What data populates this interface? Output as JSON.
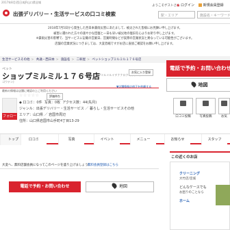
{
  "header": {
    "tagline": "2017年8月/西日本JR山口県全域",
    "logo_text": "出張デリバリー・生活サービスの口コミ検索",
    "welcome": "ようこそゲストさん",
    "login": "ログイン",
    "register": "新規会員登録",
    "search_area_placeholder": "駅・エリア",
    "search_keyword_placeholder": "施設名・キーワード"
  },
  "notice": {
    "line1": "2018年7月5日から発生した西日本豪雨災害にあたまして、被災された皆様にお見舞い申し上げます。",
    "line2": "被害に遭われた方々の速やかな回復と一日も早い被災地の復旧を心よりお祈り申し上げます。",
    "line3": "※豪雨災害の影響で、当サービスに記載の営業日、営業時間などが実際の営業状況と異なっている可能性がございます。",
    "line4": "店舗の営業状況につきましては、大変恐縮ですがお店に直接ご確認をお願い申し上げます。"
  },
  "breadcrumbs": [
    "生活サービスその他",
    "共通・西日本",
    "施設名",
    "二軒屋",
    "ペットショップミルミル１７６号店"
  ],
  "shop": {
    "category": "ペット",
    "title": "ショップミルミル１７６号店",
    "kana": "(ペットショップミルミルイチナナロクゴウテン)",
    "kana_short": "ゴウテン)",
    "edit_link": "お気に入り登録",
    "subnote": "最新の情報は店舗に確認の上ご利用ください",
    "subnote2": "▼店舗情報の修正を依頼する",
    "stars": "☆☆☆☆☆",
    "reviews_link": "評価待ち",
    "follow": "フォロー",
    "info": {
      "rating": "◆ 口コミ：0件",
      "photos": "写真：0枚",
      "access": "アクセス数：44(先月)",
      "genre": "ジャンル：出張デリバリー・生活サービス ／ 暮らし・生活サービスその他",
      "area": "エリア：山口県 ／ 岩国市周辺",
      "address": "住所：山口県岩国市山手町4丁目13-29"
    }
  },
  "actions": {
    "primary": "電話で予約・お問い合わせ",
    "map": "地図",
    "reviews_post": "口コミ投稿",
    "photo_post": "写真投稿",
    "third": "お気"
  },
  "tabs": [
    "トップ",
    "口コミ",
    "写真",
    "イベント",
    "メニュー",
    "お知らせ",
    "スタッフ"
  ],
  "main": {
    "note": "大変へ、無料店舗会員になってこのページを盛り上げましょう！",
    "note2": "無料会員登録はこちら",
    "cta": "電話で予約・お問い合わせ",
    "map": "地図"
  },
  "sidebar": {
    "heading": "この近くのお店",
    "item1": "クリーニング",
    "item1_sub": "大竹店/宮城",
    "item2": "どんなケースでも",
    "item2_sub": "お困りのことなら",
    "item3": "ホーム"
  }
}
